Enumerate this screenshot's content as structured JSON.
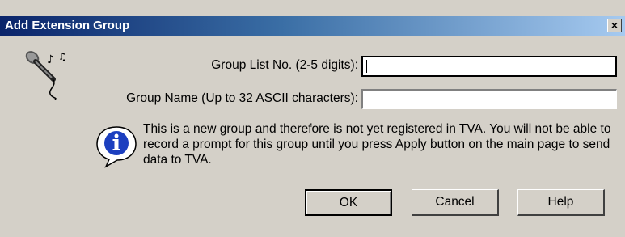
{
  "window": {
    "title": "Add Extension Group",
    "close_glyph": "×"
  },
  "form": {
    "group_list_no": {
      "label": "Group List No. (2-5 digits):",
      "value": ""
    },
    "group_name": {
      "label": "Group Name (Up to 32 ASCII characters):",
      "value": ""
    }
  },
  "info": {
    "icon": "info-icon",
    "message": "This is a new group and therefore is not yet registered in TVA. You will not be able to record a prompt for this group until you press Apply button on the main page to send data to TVA."
  },
  "buttons": {
    "ok": "OK",
    "cancel": "Cancel",
    "help": "Help"
  },
  "colors": {
    "face": "#d4d0c8",
    "title_start": "#0a246a",
    "title_end": "#a6caf0"
  }
}
